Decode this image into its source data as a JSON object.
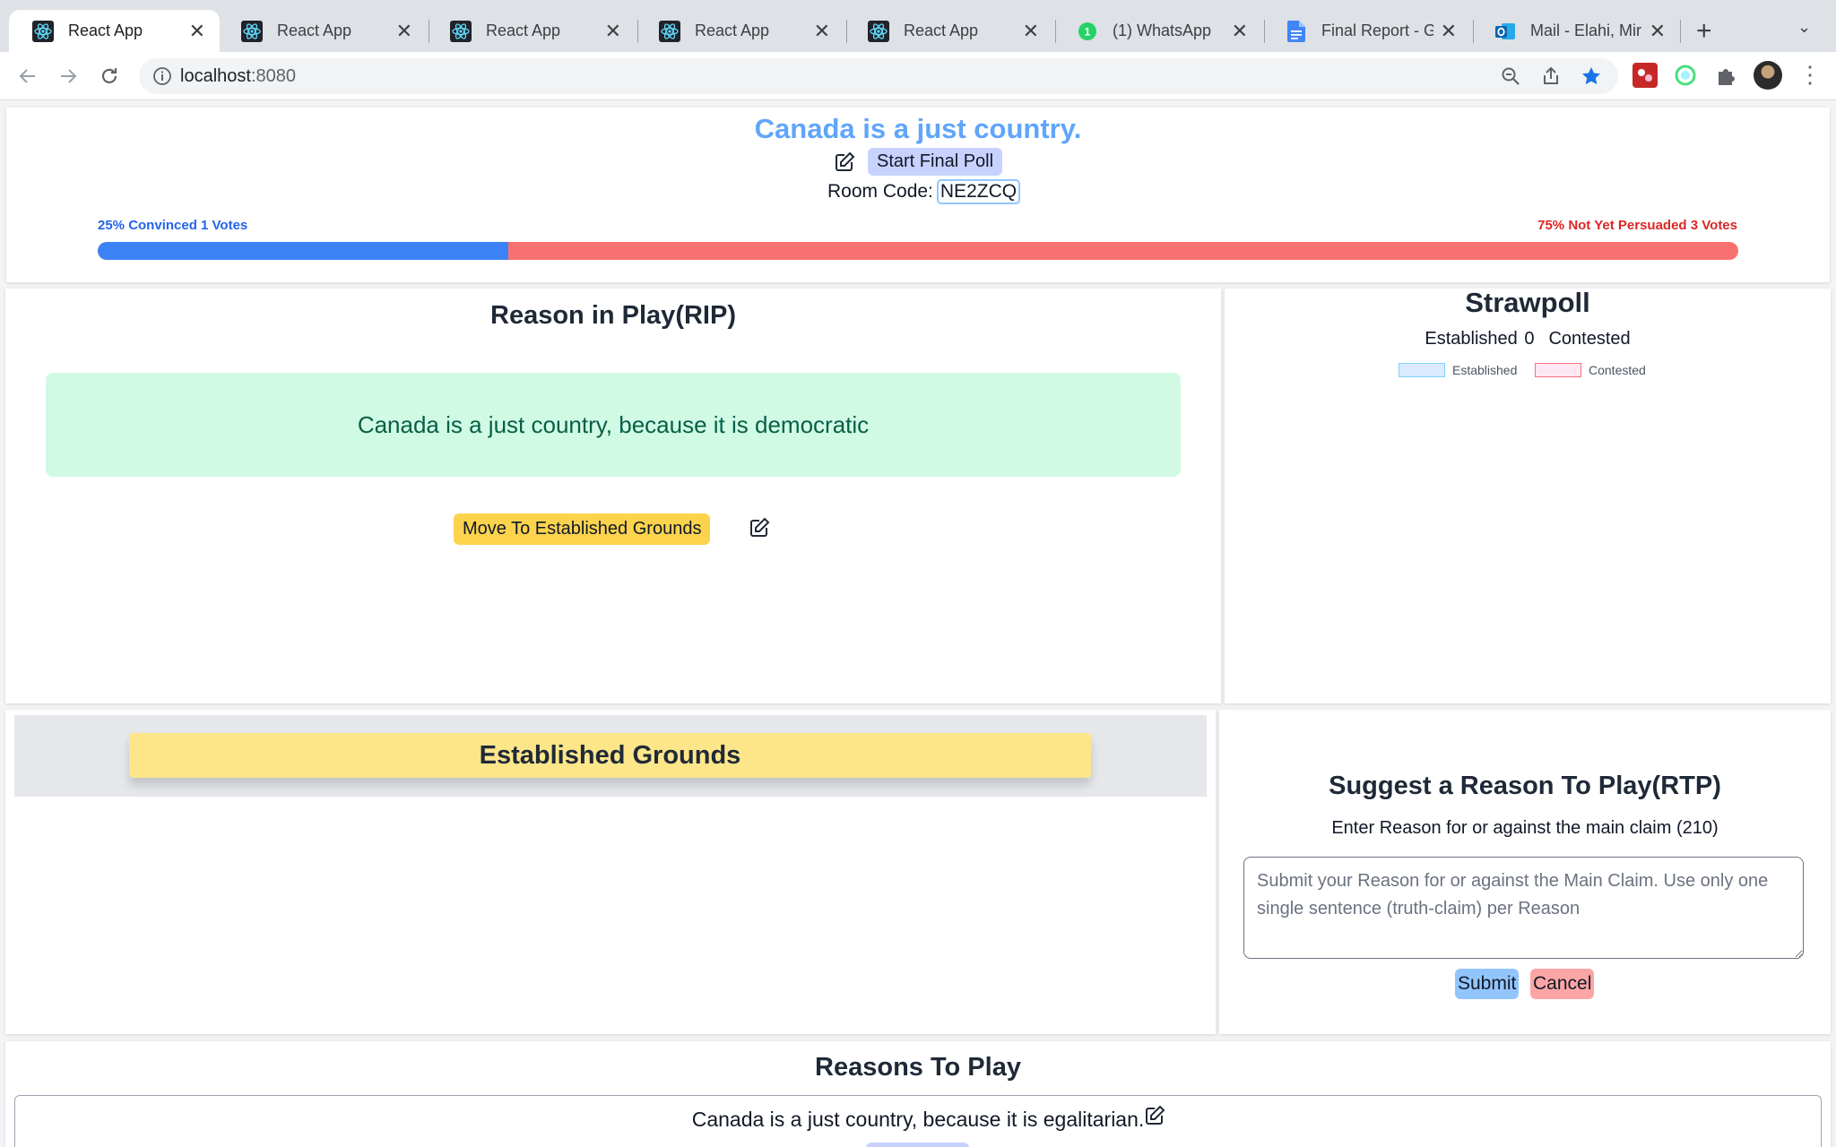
{
  "browser": {
    "tabs": [
      {
        "title": "React App",
        "favicon": "react-icon",
        "active": true
      },
      {
        "title": "React App",
        "favicon": "react-icon"
      },
      {
        "title": "React App",
        "favicon": "react-icon"
      },
      {
        "title": "React App",
        "favicon": "react-icon"
      },
      {
        "title": "React App",
        "favicon": "react-icon"
      },
      {
        "title": "(1) WhatsApp",
        "favicon": "whatsapp-icon",
        "badge": "1"
      },
      {
        "title": "Final Report - Go",
        "favicon": "google-docs-icon"
      },
      {
        "title": "Mail - Elahi, Mir A",
        "favicon": "outlook-icon"
      }
    ],
    "new_tab": "+",
    "url_host": "localhost",
    "url_port": ":8080"
  },
  "header": {
    "claim": "Canada is a just country.",
    "start_final_poll": "Start Final Poll",
    "room_code_label": "Room Code:",
    "room_code": "NE2ZCQ",
    "convinced_label": "25% Convinced 1 Votes",
    "not_persuaded_label": "75% Not Yet Persuaded 3 Votes",
    "convinced_fraction": 0.25,
    "colors": {
      "convinced": "#3b82f6",
      "not_persuaded": "#f87171",
      "claim": "#60a5fa"
    }
  },
  "rip": {
    "title": "Reason in Play(RIP)",
    "reason": "Canada is a just country, because it is democratic",
    "move_button": "Move To Established Grounds"
  },
  "strawpoll": {
    "title": "Strawpoll",
    "established_count": "Established 0",
    "contested_label": "Contested",
    "legend": [
      {
        "label": "Established",
        "fill": "#dbeafe",
        "stroke": "#7dd3fc"
      },
      {
        "label": "Contested",
        "fill": "#fce7f3",
        "stroke": "#fb7185"
      }
    ]
  },
  "established": {
    "title": "Established Grounds"
  },
  "suggest": {
    "title": "Suggest a Reason To Play(RTP)",
    "subtitle": "Enter Reason for or against the main claim (210)",
    "placeholder": "Submit your Reason for or against the Main Claim. Use only one single sentence (truth-claim) per Reason",
    "value": "",
    "submit": "Submit",
    "cancel": "Cancel"
  },
  "rtp": {
    "title": "Reasons To Play",
    "items": [
      {
        "text": "Canada is a just country, because it is egalitarian."
      }
    ]
  }
}
